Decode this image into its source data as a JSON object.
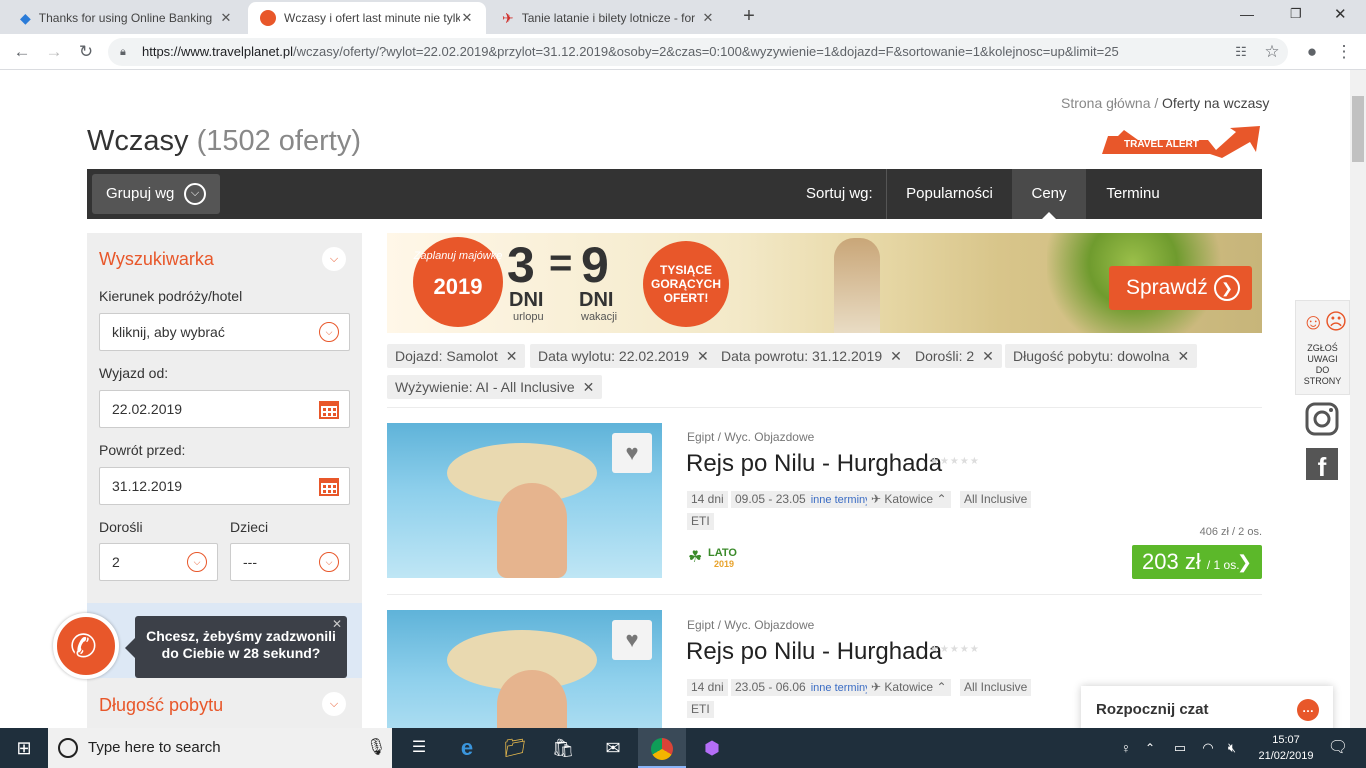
{
  "browser": {
    "tabs": [
      {
        "title": "Thanks for using Online Banking"
      },
      {
        "title": "Wczasy i ofert last minute nie tylko"
      },
      {
        "title": "Tanie latanie i bilety lotnicze - for"
      }
    ],
    "url_domain": "https://www.travelplanet.pl",
    "url_rest": "/wczasy/oferty/?wylot=22.02.2019&przylot=31.12.2019&osoby=2&czas=0:100&wyzywienie=1&dojazd=F&sortowanie=1&kolejnosc=up&limit=25"
  },
  "breadcrumb": {
    "home": "Strona główna /",
    "current": "Oferty na wczasy"
  },
  "page": {
    "title": "Wczasy",
    "count": "(1502 oferty)",
    "travel_alert": "TRAVEL ALERT"
  },
  "sortbar": {
    "group_label": "Grupuj wg",
    "sort_label": "Sortuj wg:",
    "options": [
      "Popularności",
      "Ceny",
      "Terminu"
    ],
    "active": "Ceny"
  },
  "sidebar": {
    "heading": "Wyszukiwarka",
    "destination_label": "Kierunek podróży/hotel",
    "destination_placeholder": "kliknij, aby wybrać",
    "depart_label": "Wyjazd od:",
    "depart_value": "22.02.2019",
    "return_label": "Powrót przed:",
    "return_value": "31.12.2019",
    "adults_label": "Dorośli",
    "adults_value": "2",
    "children_label": "Dzieci",
    "children_value": "---",
    "duration_heading": "Długość pobytu"
  },
  "banner": {
    "lines": [
      "Zaplanuj majówkę",
      "2019"
    ],
    "big": [
      "3",
      "=",
      "9"
    ],
    "dni1": "DNI",
    "dni1_sub": "urlopu",
    "dni2": "DNI",
    "dni2_sub": "wakacji",
    "badge": [
      "TYSIĄCE",
      "GORĄCYCH",
      "OFERT!"
    ],
    "cta": "Sprawdź"
  },
  "filters": [
    "Dojazd: Samolot",
    "Data wylotu: 22.02.2019",
    "Data powrotu: 31.12.2019",
    "Dorośli: 2",
    "Długość pobytu: dowolna",
    "Wyżywienie: AI - All Inclusive"
  ],
  "offers": [
    {
      "location": "Egipt / Wyc. Objazdowe",
      "name": "Rejs po Nilu - Hurghada",
      "stars": "★★★★★",
      "days": "14 dni",
      "dates": "09.05 - 23.05",
      "other_terms": "inne terminy",
      "airport": "Katowice",
      "board": "All Inclusive",
      "operator": "ETI",
      "season": "LATO",
      "season_year": "2019",
      "total": "406 zł / 2 os.",
      "price": "203 zł",
      "per": "/ 1 os."
    },
    {
      "location": "Egipt / Wyc. Objazdowe",
      "name": "Rejs po Nilu - Hurghada",
      "stars": "★★★★★",
      "days": "14 dni",
      "dates": "23.05 - 06.06",
      "other_terms": "inne terminy",
      "airport": "Katowice",
      "board": "All Inclusive",
      "operator": "ETI"
    }
  ],
  "widgets": {
    "feedback": [
      "ZGŁOŚ",
      "UWAGI",
      "DO",
      "STRONY"
    ],
    "call_bubble": [
      "Chcesz, żebyśmy zadzwonili",
      "do Ciebie w 28 sekund?"
    ],
    "chat": "Rozpocznij czat"
  },
  "taskbar": {
    "search_placeholder": "Type here to search",
    "time": "15:07",
    "date": "21/02/2019"
  },
  "colors": {
    "accent": "#e8572a",
    "price_green": "#5cb82a",
    "sortbar": "#333333"
  }
}
